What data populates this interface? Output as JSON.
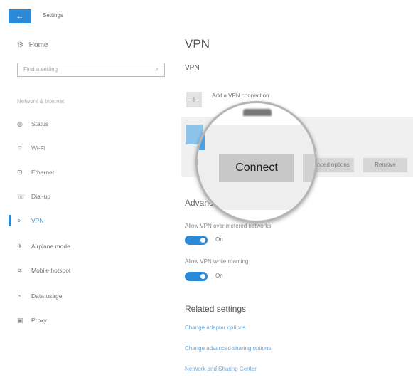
{
  "window": {
    "back_label": "←",
    "title": "Settings"
  },
  "sidebar": {
    "home": {
      "icon": "home-gear-icon",
      "label": "Home"
    },
    "search_placeholder": "Find a setting",
    "section_label": "Network & Internet",
    "items": [
      {
        "icon": "status-icon",
        "label": "Status"
      },
      {
        "icon": "wifi-icon",
        "label": "Wi-Fi"
      },
      {
        "icon": "ethernet-icon",
        "label": "Ethernet"
      },
      {
        "icon": "dialup-icon",
        "label": "Dial-up"
      },
      {
        "icon": "vpn-icon",
        "label": "VPN",
        "active": true
      },
      {
        "icon": "airplane-icon",
        "label": "Airplane mode"
      },
      {
        "icon": "hotspot-icon",
        "label": "Mobile hotspot"
      },
      {
        "icon": "data-usage-icon",
        "label": "Data usage"
      },
      {
        "icon": "proxy-icon",
        "label": "Proxy"
      }
    ]
  },
  "main": {
    "page_title": "VPN",
    "section_title": "VPN",
    "add_label": "Add a VPN connection",
    "buttons": {
      "connect": "Connect",
      "advanced": "Advanced options",
      "remove": "Remove"
    },
    "advanced_title": "Advanced Options",
    "options": [
      {
        "label": "Allow VPN over metered networks",
        "state": "On"
      },
      {
        "label": "Allow VPN while roaming",
        "state": "On"
      }
    ],
    "related_title": "Related settings",
    "links": [
      "Change adapter options",
      "Change advanced sharing options",
      "Network and Sharing Center"
    ]
  },
  "colors": {
    "accent": "#2b8ad8",
    "link": "#6fa6d4"
  }
}
